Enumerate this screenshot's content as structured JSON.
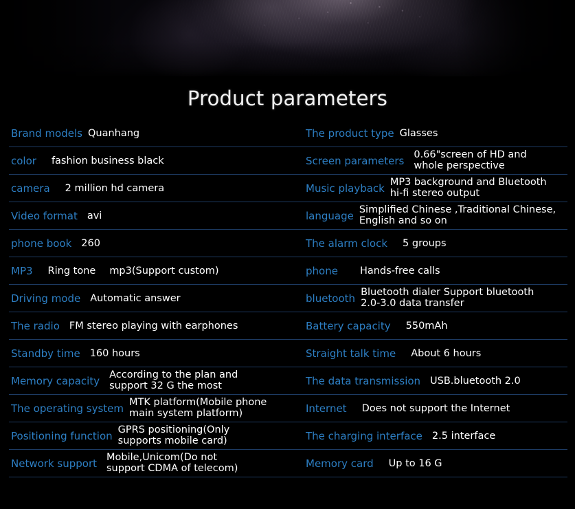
{
  "page": {
    "background_color": "#000000",
    "label_color": "#2d7fc4",
    "value_color": "#ffffff",
    "divider_color": "#1d3b63"
  },
  "banner": {
    "alt": "dark textured product hero image"
  },
  "title": "Product parameters",
  "table": {
    "rows": [
      {
        "left": {
          "label": "Brand models",
          "value": "Quanhang",
          "gap": "gap-s"
        },
        "right": {
          "label": "The product type",
          "value": "Glasses",
          "gap": "gap-s"
        }
      },
      {
        "left": {
          "label": "color",
          "value": "fashion business black",
          "gap": "gap-l"
        },
        "right": {
          "label": "Screen parameters",
          "value_line1": "0.66\"screen of HD and",
          "value_line2": "whole perspective",
          "gap": "gap-m"
        }
      },
      {
        "left": {
          "label": "camera",
          "value": "2 million hd camera",
          "gap": "gap-l"
        },
        "right": {
          "label": "Music playback",
          "value_line1": "MP3 background and Bluetooth",
          "value_line2": "hi-fi stereo output",
          "gap": "gap-s"
        }
      },
      {
        "left": {
          "label": "Video format",
          "value": "avi",
          "gap": "gap-m"
        },
        "right": {
          "label": "language",
          "value_line1": "Simplified Chinese ,Traditional Chinese,",
          "value_line2": "English and so on",
          "gap": "gap-s"
        }
      },
      {
        "left": {
          "label": "phone book",
          "value": "260",
          "gap": "gap-m"
        },
        "right": {
          "label": "The alarm clock",
          "value": "5 groups",
          "gap": "gap-l"
        }
      },
      {
        "left": {
          "label": "MP3",
          "value": "Ring tone",
          "value2": "mp3(Support custom)",
          "gap": "gap-l"
        },
        "right": {
          "label": "phone",
          "value": "Hands-free calls",
          "gap": "gap-xl"
        }
      },
      {
        "left": {
          "label": "Driving mode",
          "value": "Automatic answer",
          "gap": "gap-m"
        },
        "right": {
          "label": "bluetooth",
          "value_line1": "Bluetooth dialer   Support  bluetooth",
          "value_line2": "2.0-3.0 data transfer",
          "gap": "gap-s"
        }
      },
      {
        "left": {
          "label": "The radio",
          "value": "FM stereo playing with earphones",
          "gap": "gap-m"
        },
        "right": {
          "label": "Battery capacity",
          "value": "550mAh",
          "gap": "gap-l"
        }
      },
      {
        "left": {
          "label": "Standby time",
          "value": "160 hours",
          "gap": "gap-m"
        },
        "right": {
          "label": "Straight talk time",
          "value": "About 6 hours",
          "gap": "gap-l"
        }
      },
      {
        "left": {
          "label": "Memory capacity",
          "value_line1": "According to the plan and",
          "value_line2": "support 32 G the most",
          "gap": "gap-m"
        },
        "right": {
          "label": "The data transmission",
          "value": "USB.bluetooth 2.0",
          "gap": "gap-m"
        }
      },
      {
        "left": {
          "label": "The operating system",
          "value_line1": "MTK platform(Mobile phone",
          "value_line2": "main system platform)",
          "gap": "gap-s"
        },
        "right": {
          "label": "Internet",
          "value": "Does not support the Internet",
          "gap": "gap-l"
        }
      },
      {
        "left": {
          "label": "Positioning function",
          "value_line1": "GPRS positioning(Only",
          "value_line2": "supports mobile card)",
          "gap": "gap-s"
        },
        "right": {
          "label": "The charging interface",
          "value": "2.5 interface",
          "gap": "gap-m"
        }
      },
      {
        "left": {
          "label": "Network support",
          "value_line1": "Mobile,Unicom(Do not",
          "value_line2": "support CDMA of telecom)",
          "gap": "gap-m"
        },
        "right": {
          "label": "Memory card",
          "value": "Up to 16 G",
          "gap": "gap-l"
        }
      }
    ]
  }
}
